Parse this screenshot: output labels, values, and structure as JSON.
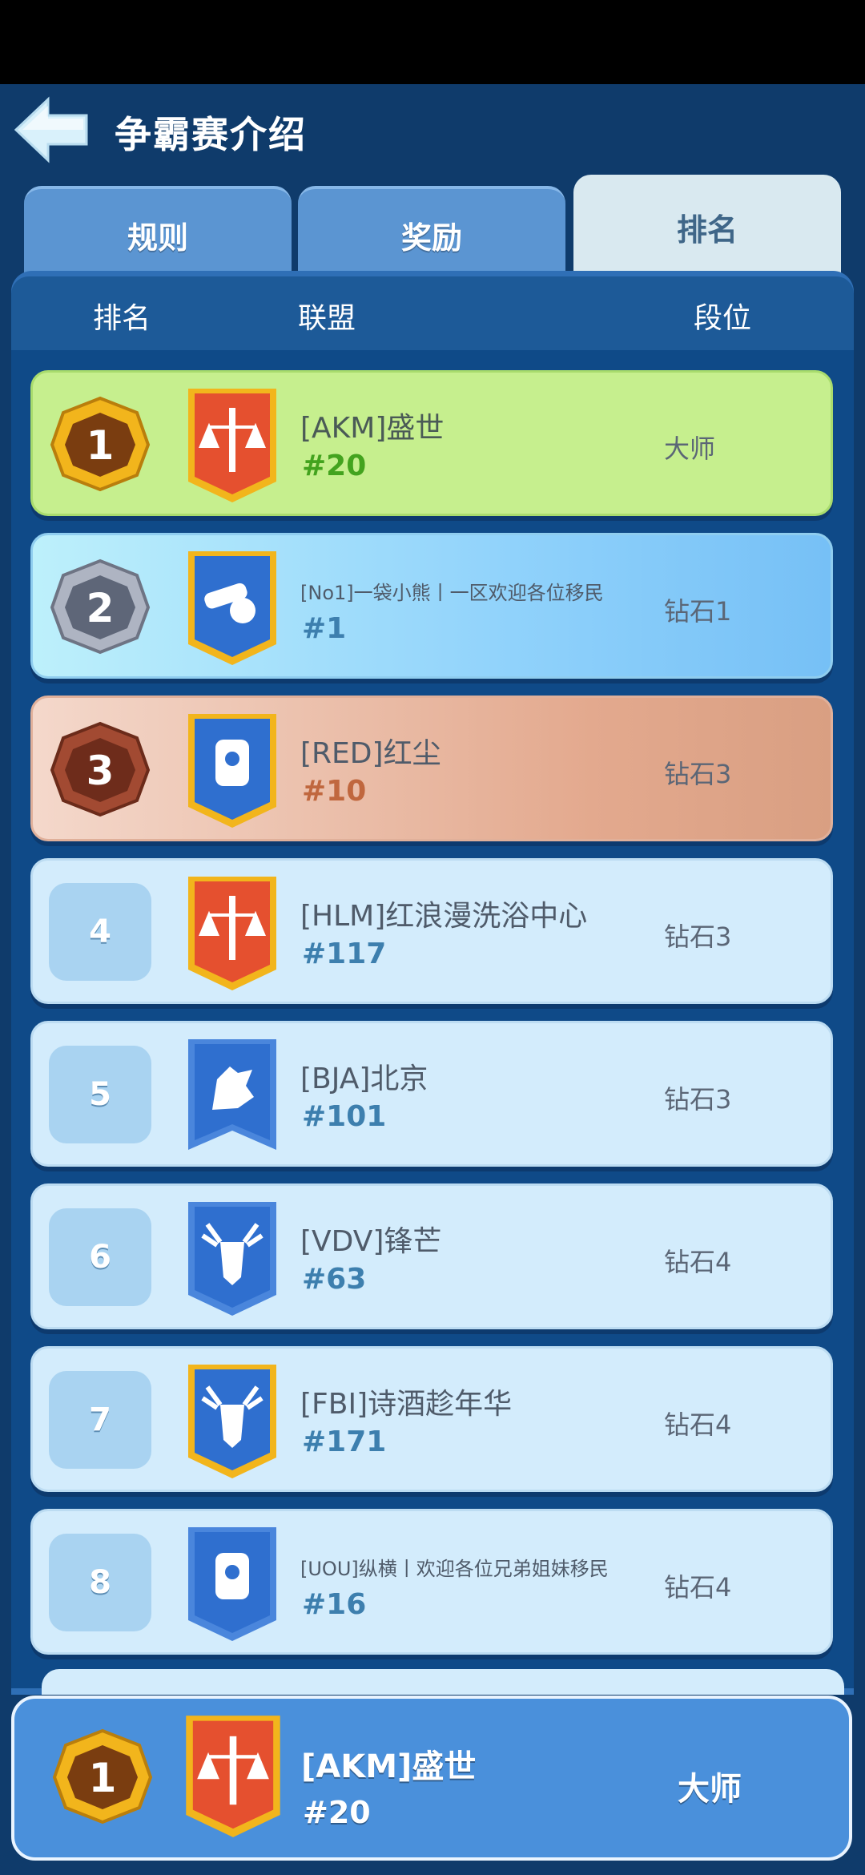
{
  "header": {
    "title": "争霸赛介绍"
  },
  "tabs": [
    {
      "label": "规则",
      "active": false
    },
    {
      "label": "奖励",
      "active": false
    },
    {
      "label": "排名",
      "active": true
    }
  ],
  "columns": {
    "rank": "排名",
    "alliance": "联盟",
    "tier": "段位"
  },
  "rows": [
    {
      "rank": "1",
      "name": "[AKM]盛世",
      "number": "#20",
      "tier": "大师",
      "badge_icon": "scales-sword-icon",
      "badge_color": "#e5502f"
    },
    {
      "rank": "2",
      "name": "[No1]一袋小熊丨一区欢迎各位移民",
      "number": "#1",
      "tier": "钻石1",
      "badge_icon": "cannon-icon",
      "badge_color": "#2f6fcf"
    },
    {
      "rank": "3",
      "name": "[RED]红尘",
      "number": "#10",
      "tier": "钻石3",
      "badge_icon": "gauntlet-icon",
      "badge_color": "#2f6fcf"
    },
    {
      "rank": "4",
      "name": "[HLM]红浪漫洗浴中心",
      "number": "#117",
      "tier": "钻石3",
      "badge_icon": "scales-sword-icon",
      "badge_color": "#e5502f"
    },
    {
      "rank": "5",
      "name": "[BJA]北京",
      "number": "#101",
      "tier": "钻石3",
      "badge_icon": "wolf-icon",
      "badge_color": "#2f6fcf"
    },
    {
      "rank": "6",
      "name": "[VDV]锋芒",
      "number": "#63",
      "tier": "钻石4",
      "badge_icon": "moose-icon",
      "badge_color": "#2f6fcf"
    },
    {
      "rank": "7",
      "name": "[FBI]诗酒趁年华",
      "number": "#171",
      "tier": "钻石4",
      "badge_icon": "moose-icon",
      "badge_color": "#2f6fcf"
    },
    {
      "rank": "8",
      "name": "[UOU]纵横丨欢迎各位兄弟姐妹移民",
      "number": "#16",
      "tier": "钻石4",
      "badge_icon": "gauntlet-icon",
      "badge_color": "#2f6fcf"
    }
  ],
  "my_alliance": {
    "rank": "1",
    "name": "[AKM]盛世",
    "number": "#20",
    "tier": "大师"
  },
  "colors": {
    "gold": "#f2b51c",
    "silver": "#8c93a3",
    "bronze": "#a24a32",
    "red_banner": "#e5502f",
    "blue_banner": "#2f6fcf"
  }
}
